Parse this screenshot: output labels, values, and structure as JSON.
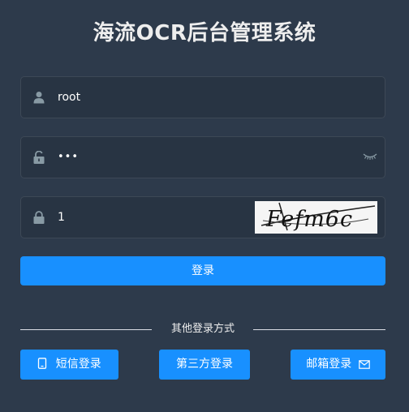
{
  "app": {
    "title": "海流OCR后台管理系统"
  },
  "form": {
    "username": {
      "value": "root",
      "icon": "user-icon"
    },
    "password": {
      "value": "•••",
      "icon": "lock-open-icon",
      "toggle_icon": "eye-closed-icon"
    },
    "code": {
      "value": "1",
      "icon": "lock-icon",
      "captcha_text": "Fefm6c"
    },
    "login_label": "登录"
  },
  "other_login": {
    "label": "其他登录方式",
    "buttons": [
      {
        "label": "短信登录",
        "icon": "mobile-icon"
      },
      {
        "label": "第三方登录"
      },
      {
        "label": "邮箱登录",
        "icon": "mail-icon"
      }
    ]
  },
  "colors": {
    "background": "#2d3a4b",
    "field_background": "#283443",
    "accent": "#1890ff",
    "icon_gray": "#889aa4"
  }
}
